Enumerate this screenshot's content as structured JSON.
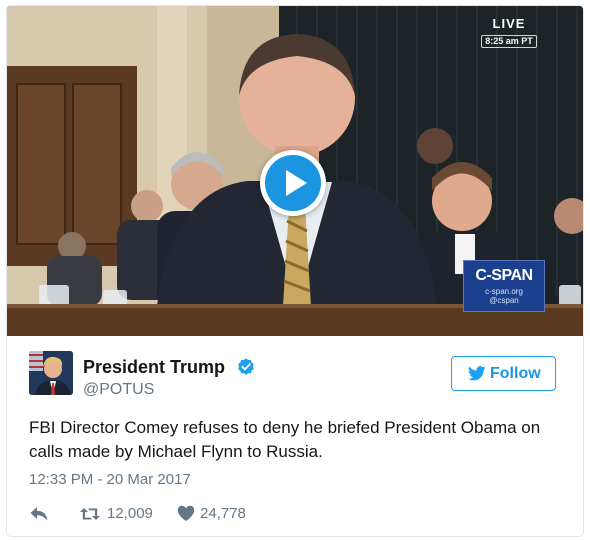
{
  "video": {
    "live_label": "LIVE",
    "live_time": "8:25 am PT",
    "channel_logo": "C-SPAN",
    "channel_url": "c-span.org",
    "channel_handle": "@cspan",
    "play_icon": "play-icon"
  },
  "tweet": {
    "display_name": "President Trump",
    "handle": "@POTUS",
    "verified_icon": "verified-badge-icon",
    "follow_label": "Follow",
    "text": "FBI Director Comey refuses to deny he briefed President Obama on calls made by Michael Flynn to Russia.",
    "timestamp": "12:33 PM - 20 Mar 2017",
    "retweet_count": "12,009",
    "like_count": "24,778"
  },
  "colors": {
    "accent": "#1b95e0",
    "secondary_text": "#657786",
    "cspan_blue": "#1d3f8f"
  }
}
